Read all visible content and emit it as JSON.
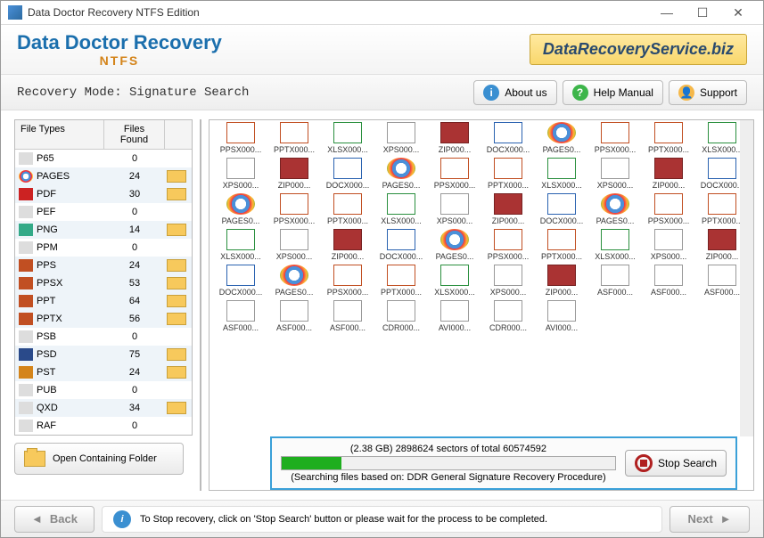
{
  "window": {
    "title": "Data Doctor Recovery NTFS Edition"
  },
  "brand": {
    "name": "Data Doctor Recovery",
    "sub": "NTFS",
    "site": "DataRecoveryService.biz"
  },
  "toolbar": {
    "mode_label": "Recovery Mode: Signature Search",
    "about": "About us",
    "help": "Help Manual",
    "support": "Support"
  },
  "file_types": {
    "col1_header": "File Types",
    "col2_header": "Files Found",
    "rows": [
      {
        "ext": "P65",
        "count": 0,
        "ico": "blank"
      },
      {
        "ext": "PAGES",
        "count": 24,
        "ico": "chrome"
      },
      {
        "ext": "PDF",
        "count": 30,
        "ico": "pdf"
      },
      {
        "ext": "PEF",
        "count": 0,
        "ico": "blank"
      },
      {
        "ext": "PNG",
        "count": 14,
        "ico": "img"
      },
      {
        "ext": "PPM",
        "count": 0,
        "ico": "blank"
      },
      {
        "ext": "PPS",
        "count": 24,
        "ico": "ppt"
      },
      {
        "ext": "PPSX",
        "count": 53,
        "ico": "ppt"
      },
      {
        "ext": "PPT",
        "count": 64,
        "ico": "ppt"
      },
      {
        "ext": "PPTX",
        "count": 56,
        "ico": "ppt"
      },
      {
        "ext": "PSB",
        "count": 0,
        "ico": "blank"
      },
      {
        "ext": "PSD",
        "count": 75,
        "ico": "psd"
      },
      {
        "ext": "PST",
        "count": 24,
        "ico": "pst"
      },
      {
        "ext": "PUB",
        "count": 0,
        "ico": "blank"
      },
      {
        "ext": "QXD",
        "count": 34,
        "ico": "blank"
      },
      {
        "ext": "RAF",
        "count": 0,
        "ico": "blank"
      }
    ]
  },
  "open_folder": "Open Containing Folder",
  "grid": {
    "row1": [
      "PPSX000...",
      "PPTX000...",
      "XLSX000...",
      "XPS000...",
      "ZIP000...",
      "DOCX000...",
      "PAGES0...",
      "PPSX000...",
      "PPTX000...",
      "XLSX000..."
    ],
    "row2": [
      "XPS000...",
      "ZIP000...",
      "DOCX000...",
      "PAGES0...",
      "PPSX000...",
      "PPTX000...",
      "XLSX000...",
      "XPS000...",
      "ZIP000...",
      "DOCX000..."
    ],
    "row3": [
      "PAGES0...",
      "PPSX000...",
      "PPTX000...",
      "XLSX000...",
      "XPS000...",
      "ZIP000...",
      "DOCX000...",
      "PAGES0...",
      "PPSX000...",
      "PPTX000..."
    ],
    "row4": [
      "XLSX000...",
      "XPS000...",
      "ZIP000...",
      "DOCX000...",
      "PAGES0...",
      "PPSX000...",
      "PPTX000...",
      "XLSX000...",
      "XPS000...",
      "ZIP000..."
    ],
    "row5": [
      "DOCX000...",
      "PAGES0...",
      "PPSX000...",
      "PPTX000...",
      "XLSX000...",
      "XPS000...",
      "ZIP000...",
      "ASF000...",
      "ASF000...",
      "ASF000..."
    ],
    "row6": [
      "ASF000...",
      "ASF000...",
      "ASF000...",
      "CDR000...",
      "AVI000...",
      "CDR000...",
      "AVI000..."
    ]
  },
  "progress": {
    "status": "(2.38 GB) 2898624  sectors  of  total 60574592",
    "detail": "(Searching files based on:  DDR General Signature Recovery Procedure)",
    "percent": 18,
    "stop_label": "Stop Search"
  },
  "footer": {
    "back": "Back",
    "next": "Next",
    "msg": "To Stop recovery, click on 'Stop Search' button or please wait for the process to be completed."
  }
}
